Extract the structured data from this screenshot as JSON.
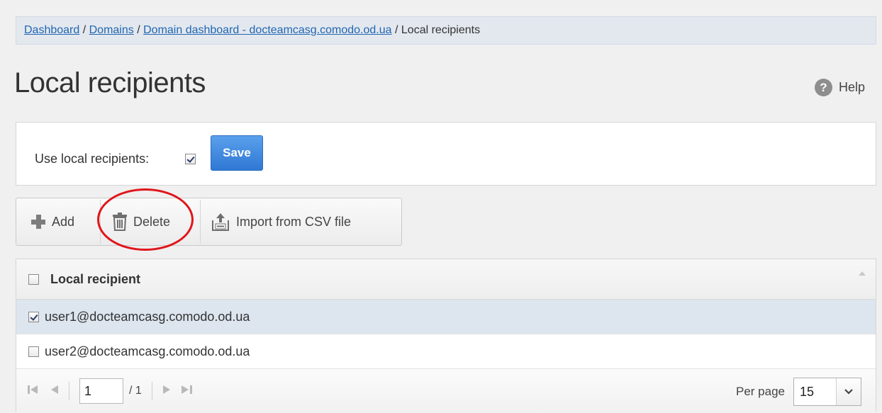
{
  "breadcrumb": {
    "items": [
      {
        "label": "Dashboard"
      },
      {
        "label": "Domains"
      },
      {
        "label": "Domain dashboard - docteamcasg.comodo.od.ua"
      }
    ],
    "current": "Local recipients",
    "separator": " / "
  },
  "page": {
    "title": "Local recipients",
    "help_label": "Help",
    "help_icon": "?"
  },
  "settings": {
    "use_local_recipients_label": "Use local recipients:",
    "use_local_recipients_checked": true,
    "save_label": "Save"
  },
  "toolbar": {
    "add_label": "Add",
    "delete_label": "Delete",
    "import_label": "Import from CSV file"
  },
  "table": {
    "header": "Local recipient",
    "rows": [
      {
        "email": "user1@docteamcasg.comodo.od.ua",
        "checked": true
      },
      {
        "email": "user2@docteamcasg.comodo.od.ua",
        "checked": false
      }
    ]
  },
  "pager": {
    "page_value": "1",
    "total_pages": "/ 1",
    "per_page_label": "Per page",
    "per_page_value": "15"
  },
  "colors": {
    "accent": "#2f78d4",
    "highlight_circle": "#e0151b",
    "selected_row": "#dde5ef"
  }
}
